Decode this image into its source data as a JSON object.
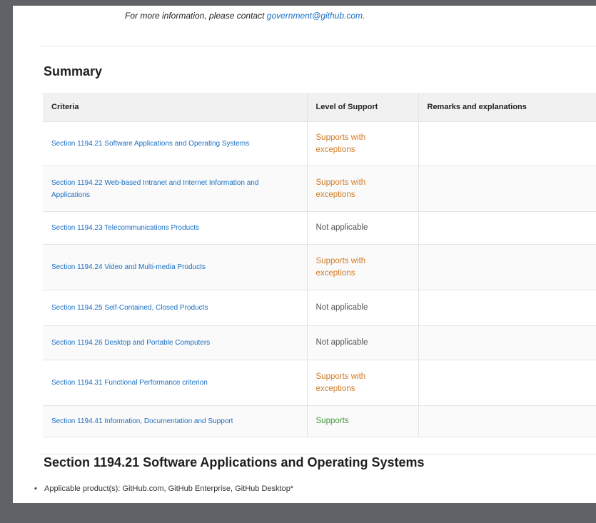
{
  "intro": {
    "contact_text": "For more information, please contact ",
    "contact_email": "government@github.com",
    "contact_suffix": "."
  },
  "summary": {
    "title": "Summary",
    "headers": [
      "Criteria",
      "Level of Support",
      "Remarks and explanations"
    ],
    "rows": [
      {
        "criteria": "Section 1194.21 Software Applications and Operating Systems",
        "level": "Supports with exceptions",
        "level_type": "exceptions",
        "remarks": ""
      },
      {
        "criteria": "Section 1194.22 Web-based Intranet and Internet Information and Applications",
        "level": "Supports with exceptions",
        "level_type": "exceptions",
        "remarks": ""
      },
      {
        "criteria": "Section 1194.23 Telecommunications Products",
        "level": "Not applicable",
        "level_type": "na",
        "remarks": ""
      },
      {
        "criteria": "Section 1194.24 Video and Multi-media Products",
        "level": "Supports with exceptions",
        "level_type": "exceptions",
        "remarks": ""
      },
      {
        "criteria": "Section 1194.25 Self-Contained, Closed Products",
        "level": "Not applicable",
        "level_type": "na",
        "remarks": ""
      },
      {
        "criteria": "Section 1194.26 Desktop and Portable Computers",
        "level": "Not applicable",
        "level_type": "na",
        "remarks": ""
      },
      {
        "criteria": "Section 1194.31 Functional Performance criterion",
        "level": "Supports with exceptions",
        "level_type": "exceptions",
        "remarks": ""
      },
      {
        "criteria": "Section 1194.41 Information, Documentation and Support",
        "level": "Supports",
        "level_type": "supports",
        "remarks": ""
      }
    ]
  },
  "section": {
    "title": "Section 1194.21 Software Applications and Operating Systems",
    "bullet": "Applicable product(s): GitHub.com, GitHub Enterprise, GitHub Desktop*"
  },
  "colors": {
    "link": "#1a6fc4",
    "exceptions": "#d07b25",
    "supports": "#3f9a3a",
    "not_applicable": "#555555"
  }
}
